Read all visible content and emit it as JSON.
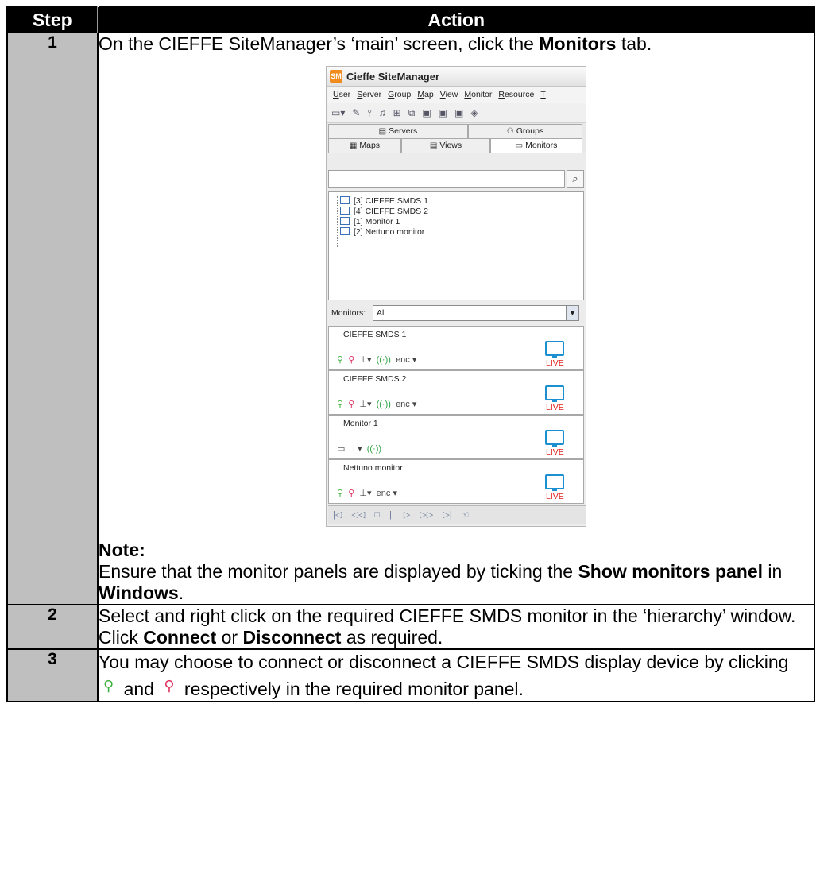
{
  "header": {
    "step": "Step",
    "action": "Action"
  },
  "rows": [
    {
      "step": "1",
      "text_a": "On the CIEFFE SiteManager’s ‘main’ screen, click the ",
      "bold_a": "Monitors",
      "text_b": " tab.",
      "note_title": "Note:",
      "note_a": "Ensure that the monitor panels are displayed by ticking the ",
      "note_bold_a": "Show monitors panel",
      "note_b": " in ",
      "note_bold_b": "Windows",
      "note_c": "."
    },
    {
      "step": "2",
      "text_a": "Select and right click on the required CIEFFE SMDS monitor in the ‘hierarchy’ window.  Click ",
      "bold_a": "Connect",
      "text_b": " or ",
      "bold_b": "Disconnect",
      "text_c": " as required."
    },
    {
      "step": "3",
      "text_a": "You may choose to connect or disconnect a CIEFFE SMDS display device by clicking ",
      "text_b": " and ",
      "text_c": " respectively in the required monitor panel.",
      "icon_connect": "connect-plug-icon",
      "icon_disconnect": "disconnect-plug-icon"
    }
  ],
  "app": {
    "logo": "SM",
    "title": "Cieffe SiteManager",
    "menu": [
      "User",
      "Server",
      "Group",
      "Map",
      "View",
      "Monitor",
      "Resource",
      "T"
    ],
    "tabs": {
      "servers": "Servers",
      "groups": "Groups",
      "maps": "Maps",
      "views": "Views",
      "monitors": "Monitors"
    },
    "tree": [
      "[3] CIEFFE SMDS 1",
      "[4] CIEFFE SMDS 2",
      "[1] Monitor 1",
      "[2] Nettuno monitor"
    ],
    "filter_label": "Monitors:",
    "filter_value": "All",
    "panels": [
      {
        "name": "CIEFFE SMDS 1",
        "status": "LIVE",
        "enc": "enc"
      },
      {
        "name": "CIEFFE SMDS 2",
        "status": "LIVE",
        "enc": "enc"
      },
      {
        "name": "Monitor 1",
        "status": "LIVE"
      },
      {
        "name": "Nettuno monitor",
        "status": "LIVE",
        "enc": "enc"
      }
    ],
    "colors": {
      "live": "#e0201d",
      "monitor": "#1b8fd0",
      "connect": "#3fb040",
      "disconnect": "#e03060",
      "logo": "#f08c1e"
    }
  }
}
